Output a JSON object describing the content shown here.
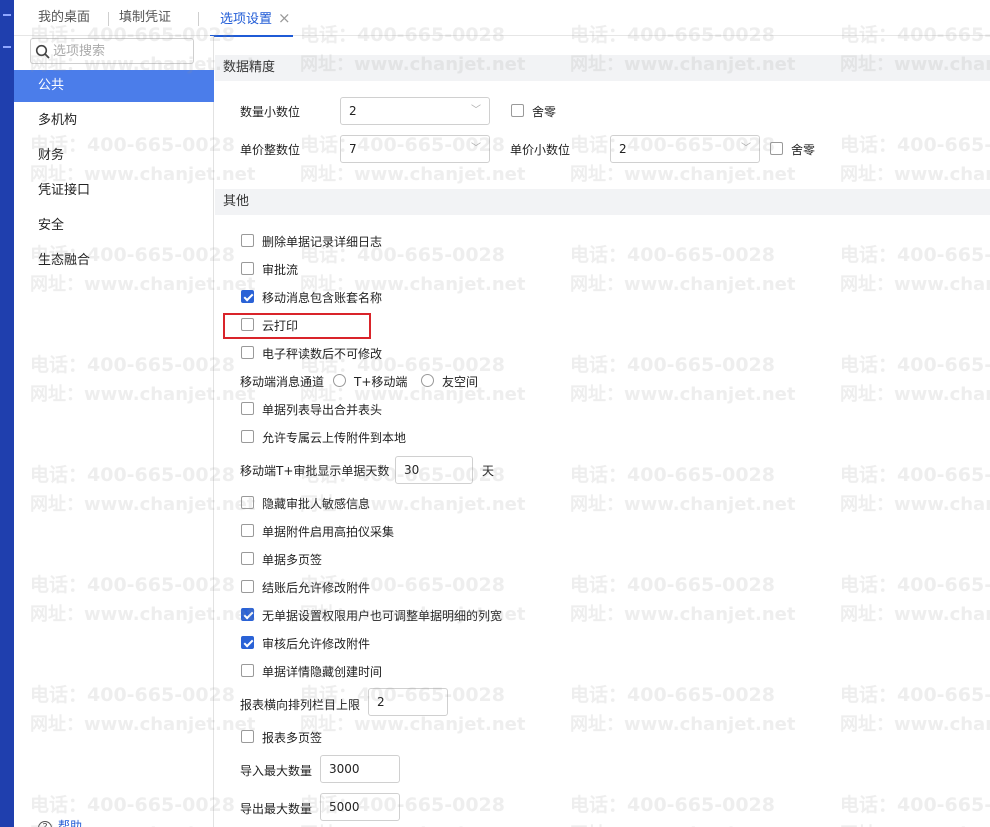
{
  "tabs": [
    {
      "label": "我的桌面"
    },
    {
      "label": "填制凭证"
    },
    {
      "label": "选项设置",
      "close": "×"
    }
  ],
  "sidebar": {
    "search_placeholder": "选项搜索",
    "items": [
      {
        "label": "公共",
        "active": true
      },
      {
        "label": "多机构"
      },
      {
        "label": "财务"
      },
      {
        "label": "凭证接口"
      },
      {
        "label": "安全"
      },
      {
        "label": "生态融合"
      }
    ],
    "help_label": "帮助"
  },
  "precision": {
    "title": "数据精度",
    "qty_decimals_label": "数量小数位",
    "qty_decimals_value": "2",
    "qty_round_label": "舍零",
    "unit_price_int_label": "单价整数位",
    "unit_price_int_value": "7",
    "unit_price_dec_label": "单价小数位",
    "unit_price_dec_value": "2",
    "unit_price_round_label": "舍零"
  },
  "other": {
    "title": "其他",
    "opt_delete_log": {
      "label": "删除单据记录详细日志",
      "checked": false
    },
    "opt_approval_flow": {
      "label": "审批流",
      "checked": false
    },
    "opt_mobile_msg_acct": {
      "label": "移动消息包含账套名称",
      "checked": true
    },
    "opt_cloud_print": {
      "label": "云打印",
      "checked": false
    },
    "opt_scale_readonly": {
      "label": "电子秤读数后不可修改",
      "checked": false
    },
    "mobile_channel": {
      "label": "移动端消息通道",
      "opt1": "T+移动端",
      "opt2": "友空间"
    },
    "opt_export_merge_header": {
      "label": "单据列表导出合并表头",
      "checked": false
    },
    "opt_allow_upload_local": {
      "label": "允许专属云上传附件到本地",
      "checked": false
    },
    "mobile_days": {
      "label": "移动端T+审批显示单据天数",
      "value": "30",
      "unit": "天"
    },
    "opt_hide_approver_sensitive": {
      "label": "隐藏审批人敏感信息",
      "checked": false
    },
    "opt_attachment_scanner": {
      "label": "单据附件启用高拍仪采集",
      "checked": false
    },
    "opt_multi_page": {
      "label": "单据多页签",
      "checked": false
    },
    "opt_after_close_edit_attach": {
      "label": "结账后允许修改附件",
      "checked": false
    },
    "opt_no_perm_col_width": {
      "label": "无单据设置权限用户也可调整单据明细的列宽",
      "checked": true
    },
    "opt_after_audit_edit_attach": {
      "label": "审核后允许修改附件",
      "checked": true
    },
    "opt_hide_create_time": {
      "label": "单据详情隐藏创建时间",
      "checked": false
    },
    "report_col_limit": {
      "label": "报表横向排列栏目上限",
      "value": "2"
    },
    "opt_report_multi_page": {
      "label": "报表多页签",
      "checked": false
    },
    "import_max": {
      "label": "导入最大数量",
      "value": "3000"
    },
    "export_max": {
      "label": "导出最大数量",
      "value": "5000"
    }
  },
  "watermark": {
    "phone": "电话：400-665-0028",
    "web": "网址：www.chanjet.net"
  },
  "colors": {
    "accent": "#1f5bd6",
    "sidebar_active": "#4b7dea",
    "checkbox_on": "#2a62d6",
    "highlight_box": "#d9242a"
  }
}
